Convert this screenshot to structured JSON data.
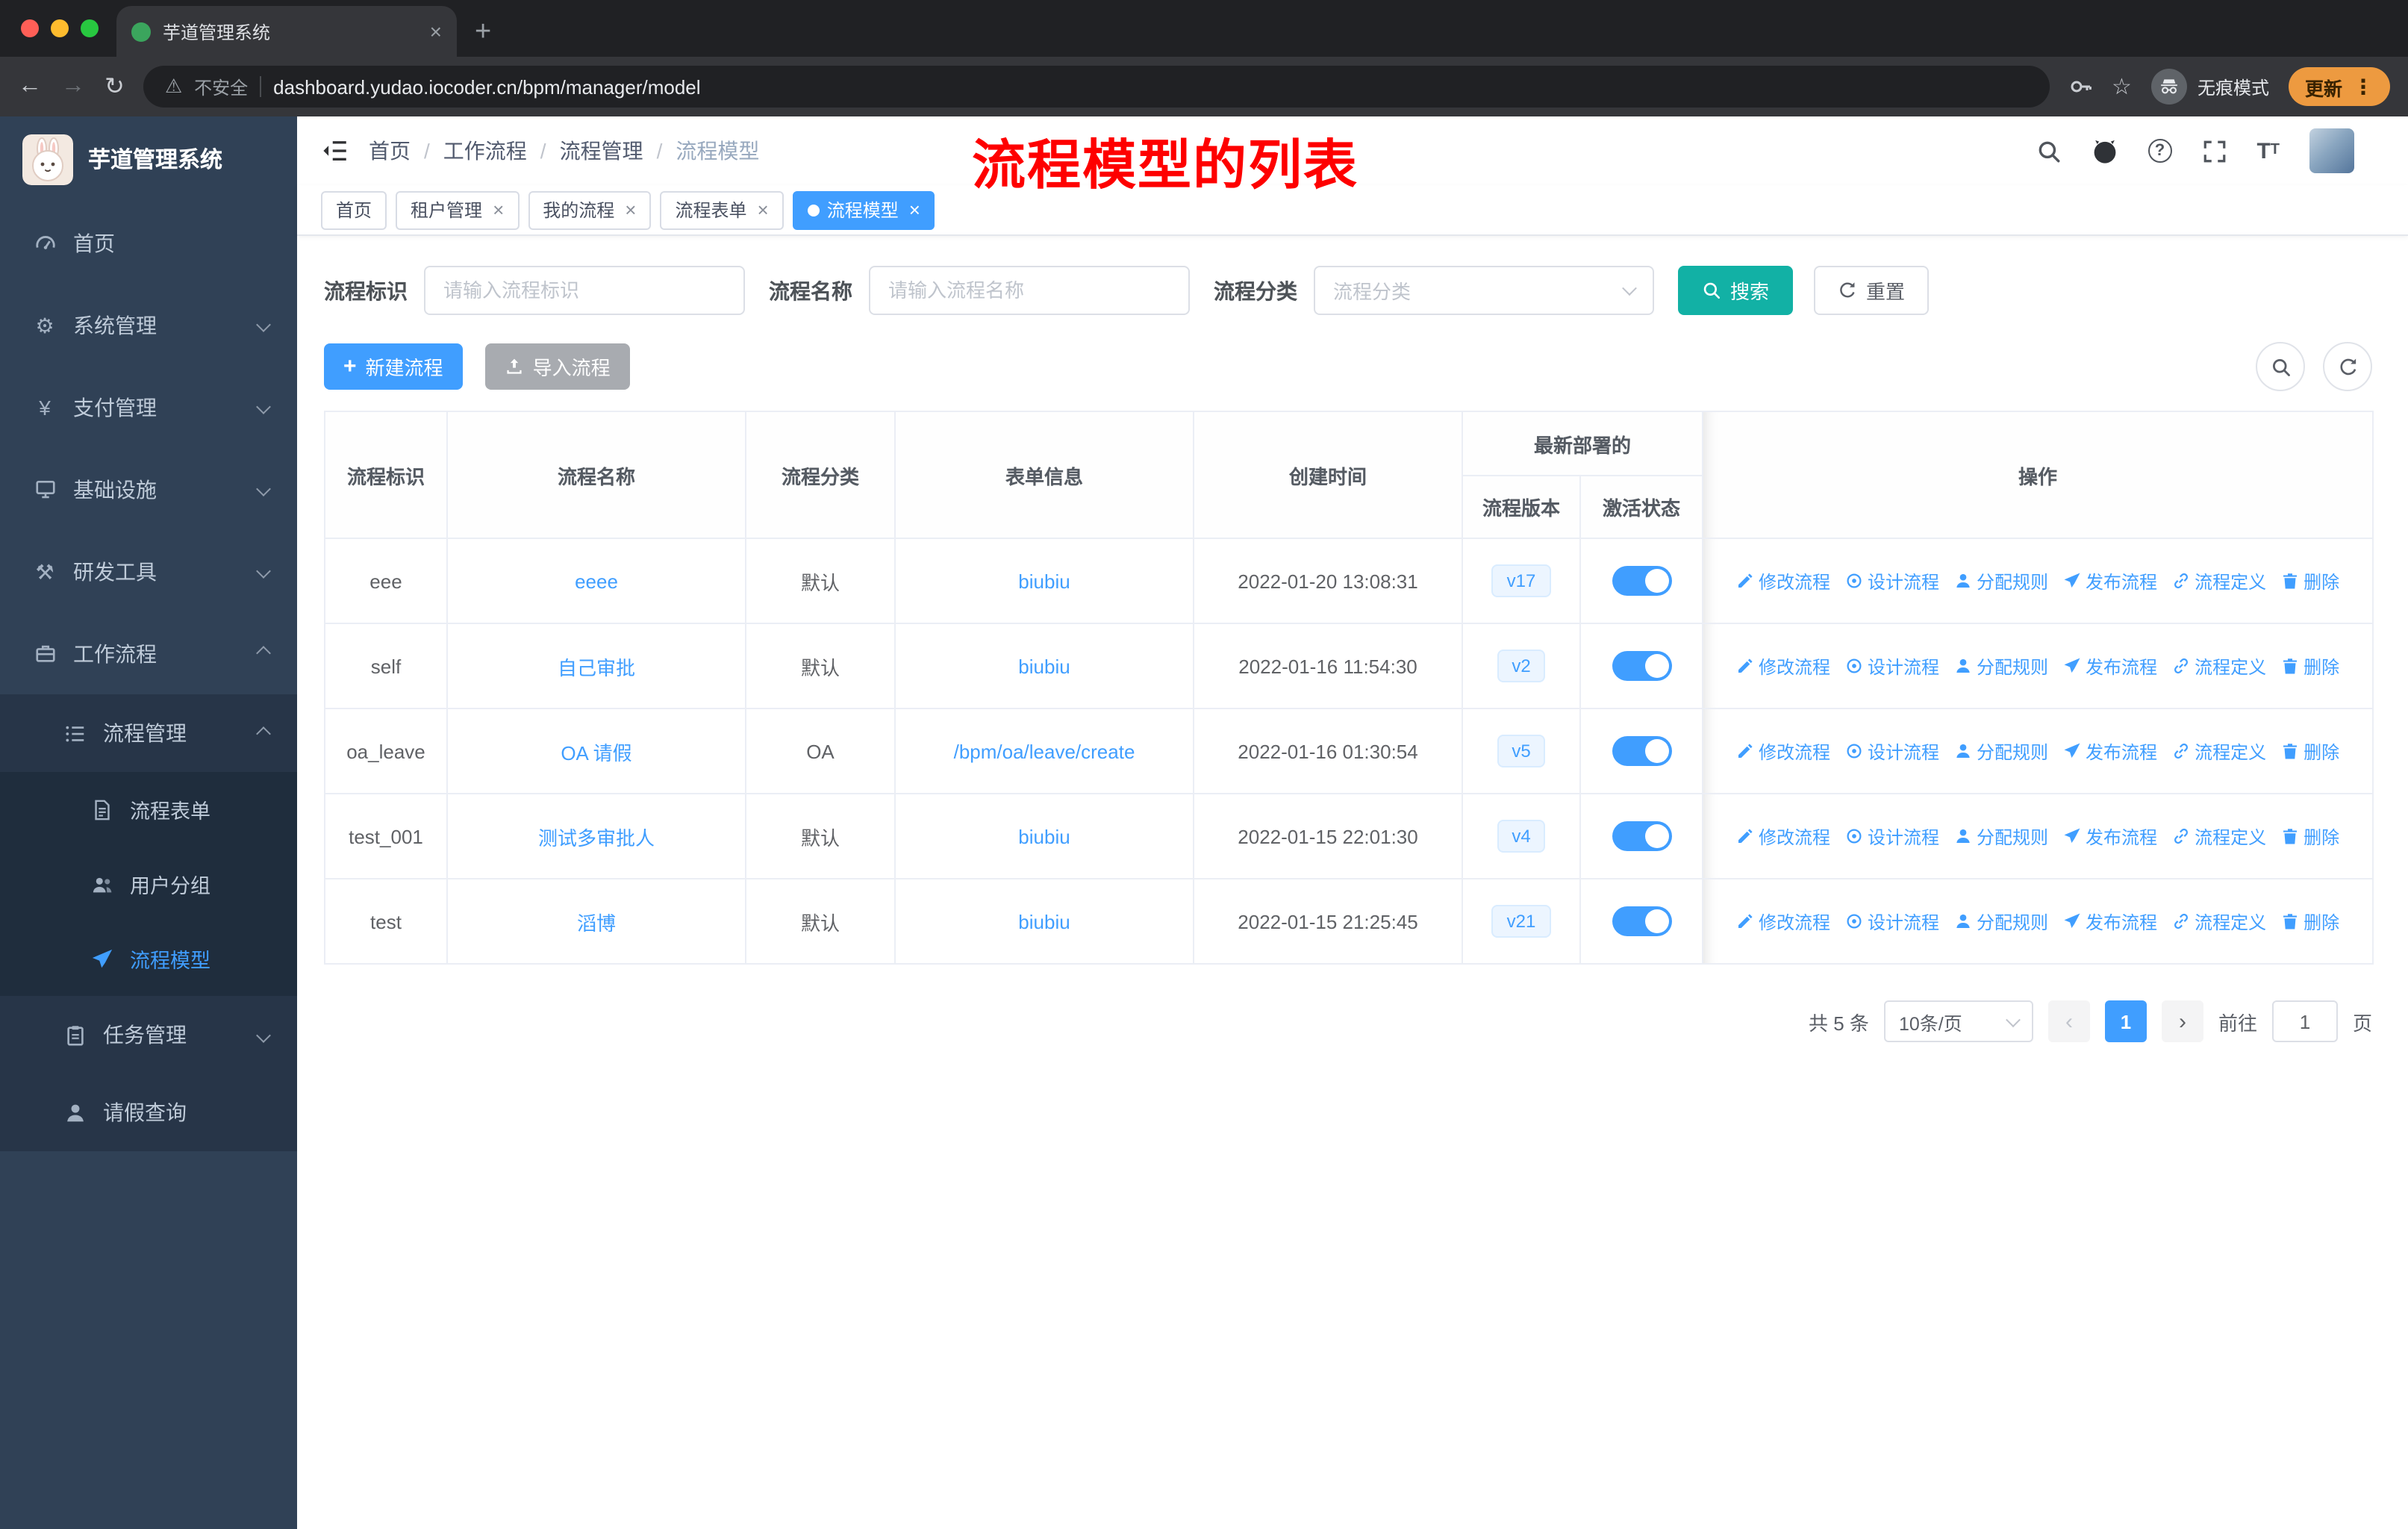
{
  "browser": {
    "tab_title": "芋道管理系统",
    "security_label": "不安全",
    "url": "dashboard.yudao.iocoder.cn/bpm/manager/model",
    "incognito_label": "无痕模式",
    "update_label": "更新"
  },
  "sidebar": {
    "app_title": "芋道管理系统",
    "items": [
      {
        "label": "首页",
        "level": 0
      },
      {
        "label": "系统管理",
        "level": 0,
        "expanded": false
      },
      {
        "label": "支付管理",
        "level": 0,
        "expanded": false
      },
      {
        "label": "基础设施",
        "level": 0,
        "expanded": false
      },
      {
        "label": "研发工具",
        "level": 0,
        "expanded": false
      },
      {
        "label": "工作流程",
        "level": 0,
        "expanded": true
      },
      {
        "label": "流程管理",
        "level": 1,
        "expanded": true
      },
      {
        "label": "流程表单",
        "level": 2
      },
      {
        "label": "用户分组",
        "level": 2
      },
      {
        "label": "流程模型",
        "level": 2,
        "active": true
      },
      {
        "label": "任务管理",
        "level": 1,
        "expanded": false
      },
      {
        "label": "请假查询",
        "level": 1
      }
    ]
  },
  "header": {
    "breadcrumb": [
      "首页",
      "工作流程",
      "流程管理",
      "流程模型"
    ],
    "annotation": "流程模型的列表"
  },
  "tags": [
    {
      "label": "首页",
      "active": false,
      "closable": false
    },
    {
      "label": "租户管理",
      "active": false,
      "closable": true
    },
    {
      "label": "我的流程",
      "active": false,
      "closable": true
    },
    {
      "label": "流程表单",
      "active": false,
      "closable": true
    },
    {
      "label": "流程模型",
      "active": true,
      "closable": true
    }
  ],
  "filters": {
    "id_label": "流程标识",
    "id_placeholder": "请输入流程标识",
    "name_label": "流程名称",
    "name_placeholder": "请输入流程名称",
    "category_label": "流程分类",
    "category_placeholder": "流程分类",
    "search_label": "搜索",
    "reset_label": "重置"
  },
  "toolbar": {
    "create_label": "新建流程",
    "import_label": "导入流程"
  },
  "table": {
    "headers": {
      "id": "流程标识",
      "name": "流程名称",
      "category": "流程分类",
      "form": "表单信息",
      "created": "创建时间",
      "group": "最新部署的",
      "version": "流程版本",
      "active": "激活状态",
      "ops": "操作"
    },
    "ops": [
      "修改流程",
      "设计流程",
      "分配规则",
      "发布流程",
      "流程定义",
      "删除"
    ],
    "rows": [
      {
        "id": "eee",
        "name": "eeee",
        "category": "默认",
        "form": "biubiu",
        "created": "2022-01-20 13:08:31",
        "version": "v17",
        "active": true
      },
      {
        "id": "self",
        "name": "自己审批",
        "category": "默认",
        "form": "biubiu",
        "created": "2022-01-16 11:54:30",
        "version": "v2",
        "active": true
      },
      {
        "id": "oa_leave",
        "name": "OA 请假",
        "category": "OA",
        "form": "/bpm/oa/leave/create",
        "created": "2022-01-16 01:30:54",
        "version": "v5",
        "active": true
      },
      {
        "id": "test_001",
        "name": "测试多审批人",
        "category": "默认",
        "form": "biubiu",
        "created": "2022-01-15 22:01:30",
        "version": "v4",
        "active": true
      },
      {
        "id": "test",
        "name": "滔博",
        "category": "默认",
        "form": "biubiu",
        "created": "2022-01-15 21:25:45",
        "version": "v21",
        "active": true
      }
    ]
  },
  "pagination": {
    "total": "共 5 条",
    "page_size": "10条/页",
    "page": "1",
    "goto_label": "前往",
    "goto_value": "1",
    "unit_label": "页"
  },
  "colors": {
    "accent": "#409EFF",
    "search_button": "#12B1A5",
    "annotation": "#FF0000",
    "sidebar_bg": "#304156",
    "toggle_on": "#409EFF",
    "version_badge": "#409EFF",
    "tag_active": "#409EFF",
    "update_pill": "#ED9A40"
  }
}
